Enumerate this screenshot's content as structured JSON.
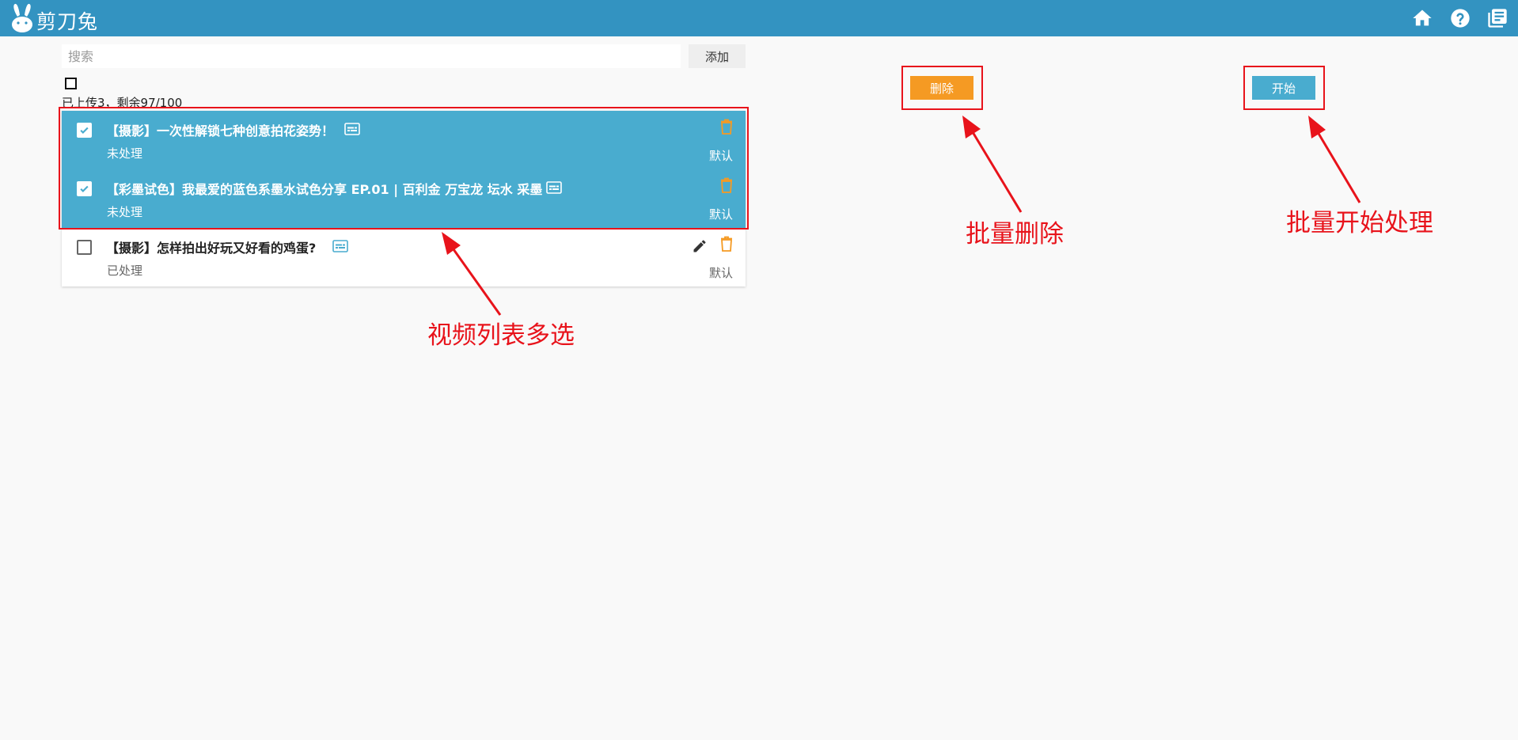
{
  "app": {
    "title": "剪刀兔"
  },
  "search": {
    "placeholder": "搜索",
    "value": ""
  },
  "toolbar": {
    "add_label": "添加",
    "delete_label": "删除",
    "start_label": "开始"
  },
  "upload_status": "已上传3，剩余97/100",
  "videos": [
    {
      "title": "【摄影】一次性解锁七种创意拍花姿势！",
      "status": "未处理",
      "preset": "默认",
      "selected": true
    },
    {
      "title": "【彩墨试色】我最爱的蓝色系墨水试色分享 EP.01 | 百利金 万宝龙 坛水 采墨",
      "status": "未处理",
      "preset": "默认",
      "selected": true
    },
    {
      "title": "【摄影】怎样拍出好玩又好看的鸡蛋?",
      "status": "已处理",
      "preset": "默认",
      "selected": false
    }
  ],
  "annotations": {
    "list_multiselect": "视频列表多选",
    "batch_delete": "批量删除",
    "batch_start": "批量开始处理"
  },
  "colors": {
    "header": "#3393c1",
    "selected_row": "#49accf",
    "delete_button": "#f59a23",
    "start_button": "#49accf",
    "trash_icon": "#f59a23",
    "subtitle_icon": "#49accf",
    "annotation_red": "#e8131b"
  },
  "icons": {
    "logo": "rabbit-logo-icon",
    "home": "home-icon",
    "help": "help-icon",
    "library": "library-icon",
    "subtitle": "subtitles-icon",
    "trash": "trash-icon",
    "edit": "pencil-icon",
    "check": "check-icon"
  }
}
